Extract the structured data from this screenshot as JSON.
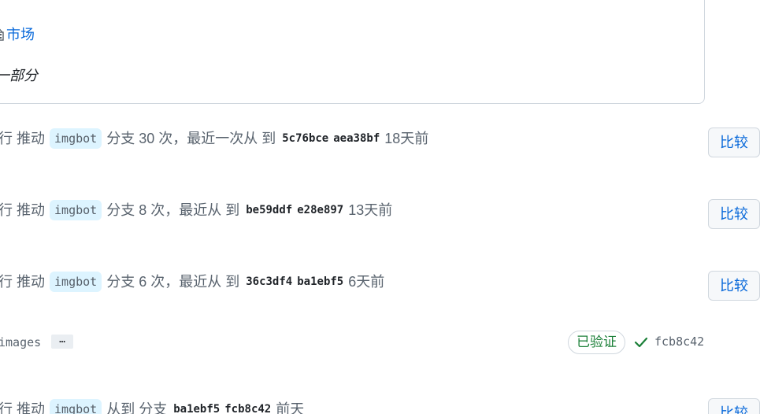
{
  "card": {
    "market_link": "市场",
    "part_text": "一部分"
  },
  "events": [
    {
      "prefix": "行 推动",
      "branch": "imgbot",
      "middle": "分支 30 次，最近一次从 到",
      "sha_from": "5c76bce",
      "sha_to": "aea38bf",
      "time": "18天前",
      "compare_label": "比较"
    },
    {
      "prefix": "行 推动",
      "branch": "imgbot",
      "middle": "分支 8 次，最近从 到",
      "sha_from": "be59ddf",
      "sha_to": "e28e897",
      "time": "13天前",
      "compare_label": "比较"
    },
    {
      "prefix": "行 推动",
      "branch": "imgbot",
      "middle": "分支 6 次，最近从 到",
      "sha_from": "36c3df4",
      "sha_to": "ba1ebf5",
      "time": "6天前",
      "compare_label": "比较"
    },
    {
      "prefix": "行 推动",
      "branch": "imgbot",
      "middle": "从到 分支",
      "sha_from": "ba1ebf5",
      "sha_to": "fcb8c42",
      "time": "前天",
      "compare_label": "比较"
    }
  ],
  "commit": {
    "message": "images",
    "ellipsis": "…",
    "verified_label": "已验证",
    "sha": "fcb8c42",
    "check_icon": "check-icon"
  },
  "colors": {
    "link": "#0969da",
    "verified": "#1a7f37",
    "branch_bg": "#ddf4ff"
  }
}
